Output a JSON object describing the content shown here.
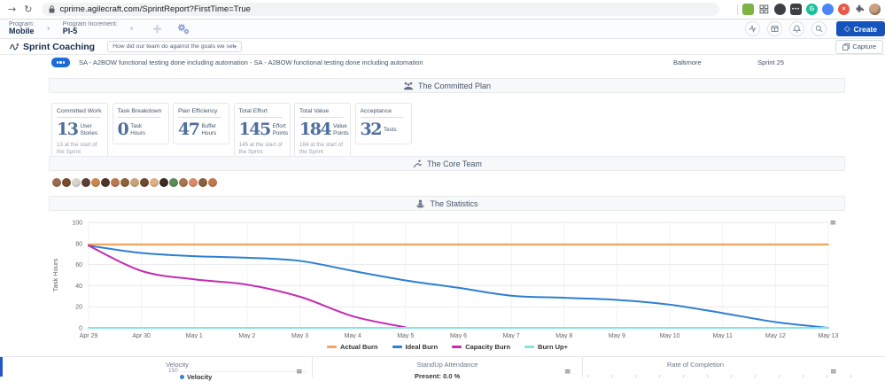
{
  "browser": {
    "url": "cprime.agilecraft.com/SprintReport?FirstTime=True"
  },
  "icons": {
    "forward": "→",
    "reload": "↻",
    "menu": "≡",
    "caret": "▾",
    "diamond": "◇",
    "dots": "•••",
    "grammarly_letter": "G",
    "close_letter": "×"
  },
  "toolbar": {
    "program_label": "Program:",
    "program_value": "Mobile",
    "pi_label": "Program Increment:",
    "pi_value": "PI-5",
    "create_label": "Create"
  },
  "header": {
    "title": "Sprint Coaching",
    "question": "How did our team do against the goals we set for this ...",
    "capture_label": "Capture"
  },
  "sprint_info": {
    "goal_text": "SA - A2BOW functional testing done including automation - SA - A2BOW functional testing done including automation",
    "team": "Baltimore",
    "sprint": "Sprint 25"
  },
  "sections": {
    "committed_plan": "The Committed Plan",
    "core_team": "The Core Team",
    "statistics": "The Statistics"
  },
  "cards": [
    {
      "title": "Committed Work",
      "value": "13",
      "unit": "User Stories",
      "note": "13 at the start of the Sprint"
    },
    {
      "title": "Task Breakdown",
      "value": "0",
      "unit": "Task Hours",
      "note": ""
    },
    {
      "title": "Plan Efficiency",
      "value": "47",
      "unit": "Buffer Hours",
      "note": ""
    },
    {
      "title": "Total Effort",
      "value": "145",
      "unit": "Effort Points",
      "note": "145 at the start of the Sprint"
    },
    {
      "title": "Total Value",
      "value": "184",
      "unit": "Value Points",
      "note": "184 at the start of the Sprint"
    },
    {
      "title": "Acceptance",
      "value": "32",
      "unit": "Tests",
      "note": ""
    }
  ],
  "team_avatars": {
    "count": 17,
    "colors": [
      "#9c6b4f",
      "#7a4b2e",
      "#d8d3cc",
      "#5d4037",
      "#c98850",
      "#4a3528",
      "#b97b4e",
      "#8c6239",
      "#caa472",
      "#6e4a2f",
      "#e0b084",
      "#3e2c23",
      "#5a8a58",
      "#a8744f",
      "#d98b6a",
      "#8b5e3c",
      "#c4764e"
    ]
  },
  "chart_data": {
    "type": "line",
    "title": "",
    "xlabel": "",
    "ylabel": "Task Hours",
    "ylim": [
      0,
      100
    ],
    "yticks": [
      0,
      20,
      40,
      60,
      80,
      100
    ],
    "grid": true,
    "legend_position": "bottom",
    "categories": [
      "Apr 29",
      "Apr 30",
      "May 1",
      "May 2",
      "May 3",
      "May 4",
      "May 5",
      "May 6",
      "May 7",
      "May 8",
      "May 9",
      "May 10",
      "May 11",
      "May 12",
      "May 13"
    ],
    "series": [
      {
        "name": "Actual Burn",
        "color": "#f7a35c",
        "values": [
          79,
          79,
          79,
          79,
          79,
          79,
          79,
          79,
          79,
          79,
          79,
          79,
          79,
          79,
          79
        ]
      },
      {
        "name": "Ideal Burn",
        "color": "#2e7fd1",
        "values": [
          78,
          71,
          68,
          66.5,
          63.5,
          54,
          45,
          38,
          30.5,
          28.5,
          26.5,
          22,
          14,
          5.5,
          0
        ]
      },
      {
        "name": "Capacity Burn",
        "color": "#c42cb2",
        "values": [
          78,
          54,
          46,
          41,
          29.5,
          11,
          0.5,
          null,
          null,
          null,
          null,
          null,
          null,
          null,
          null
        ]
      },
      {
        "name": "Burn Up+",
        "color": "#86e3e0",
        "values": [
          0,
          0,
          0,
          0,
          0,
          0,
          0,
          0,
          0,
          0,
          0,
          0,
          0,
          0,
          0
        ]
      }
    ]
  },
  "bottom": {
    "velocity": {
      "title": "Velocity",
      "tick": "150",
      "legend": "Velocity"
    },
    "standup": {
      "title": "StandUp Attendance",
      "stat": "Present: 0.0 %"
    },
    "rate": {
      "title": "Rate of Completion"
    }
  }
}
